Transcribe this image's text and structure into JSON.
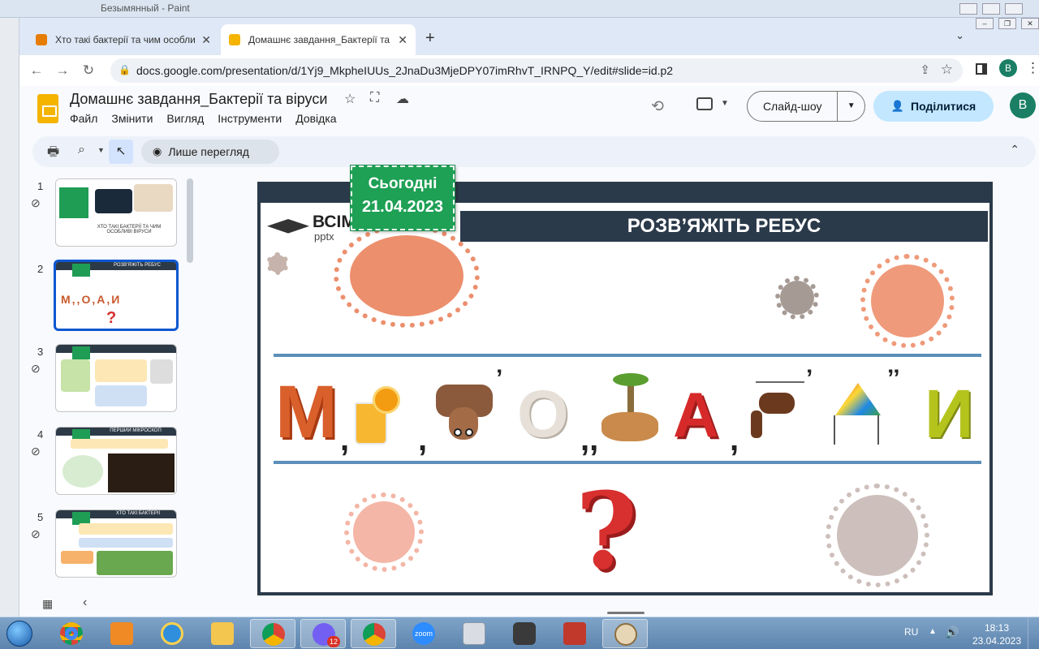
{
  "background_window": {
    "title": "Безымянный - Paint"
  },
  "browser": {
    "tabs": [
      {
        "label": "Хто такі бактерії та чим особливі віруси",
        "favicon_color": "#e67c00"
      },
      {
        "label": "Домашнє завдання_Бактерії та віруси",
        "favicon_color": "#f4b400"
      }
    ],
    "url": "docs.google.com/presentation/d/1Yj9_MkpheIUUs_2JnaDu3MjeDPY07imRhvT_IRNPQ_Y/edit#slide=id.p2",
    "profile_initial": "B"
  },
  "app": {
    "doc_title": "Домашнє завдання_Бактерії та віруси",
    "menu": [
      "Файл",
      "Змінити",
      "Вигляд",
      "Інструменти",
      "Довідка"
    ],
    "slideshow_label": "Слайд-шоу",
    "share_label": "Поділитися",
    "user_initial": "B",
    "view_only_label": "Лише перегляд",
    "accent": "#0b57d0"
  },
  "filmstrip": {
    "slides": [
      {
        "number": "1",
        "caption": "ХТО ТАКІ БАКТЕРІЇ ТА ЧИМ ОСОБЛИВІ ВІРУСИ",
        "has_link": true
      },
      {
        "number": "2",
        "caption": "РОЗВ'ЯЖІТЬ РЕБУС",
        "has_link": false,
        "selected": true
      },
      {
        "number": "3",
        "caption": "",
        "has_link": true
      },
      {
        "number": "4",
        "caption": "ПЕРШИЙ МІКРОСКОП",
        "has_link": true
      },
      {
        "number": "5",
        "caption": "ХТО ТАКІ БАКТЕРІЇ",
        "has_link": true
      }
    ]
  },
  "slide": {
    "brand_main": "ВСІМ",
    "brand_sub": "pptx",
    "date_line1": "Сьогодні",
    "date_line2": "21.04.2023",
    "heading": "РОЗВ’ЯЖІТЬ РЕБУС",
    "rebus": {
      "letter_m": "М",
      "letter_o": "О",
      "letter_a": "А",
      "letter_i": "И",
      "comma": ",",
      "double_comma": ",,",
      "apostrophe": "’",
      "double_apostrophe": "’’"
    },
    "question": "?"
  },
  "taskbar": {
    "viber_badge": "12",
    "zoom_label": "zoom",
    "language": "RU",
    "time": "18:13",
    "date": "23.04.2023"
  }
}
